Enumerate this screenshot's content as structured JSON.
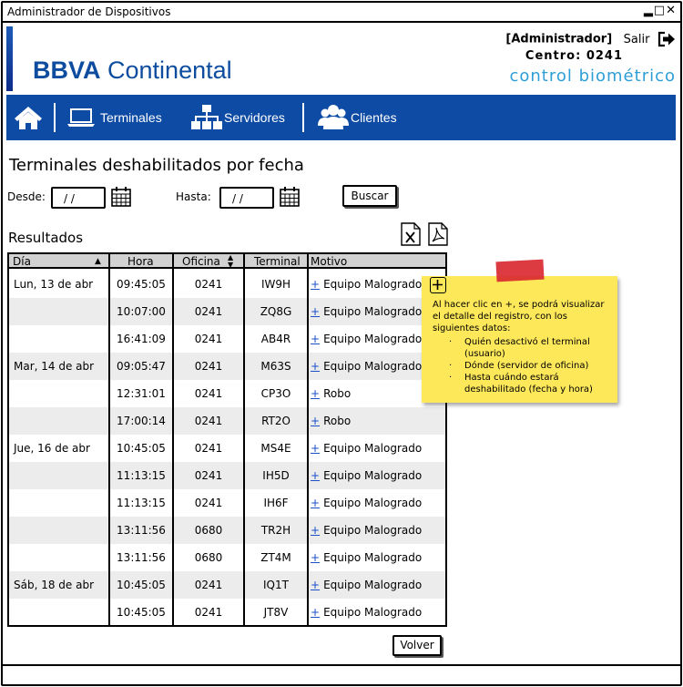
{
  "window": {
    "title": "Administrador de Dispositivos",
    "controls": "▂□✕"
  },
  "brand": {
    "logo_bold": "BBVA",
    "logo_rest": " Continental",
    "subtitle": "control biométrico"
  },
  "user": {
    "role": "[Administrador]",
    "logout": "Salir",
    "centro": "Centro: 0241"
  },
  "nav": [
    {
      "label": "",
      "icon": "home-icon"
    },
    {
      "label": "Terminales",
      "icon": "laptop-icon"
    },
    {
      "label": "Servidores",
      "icon": "sitemap-icon"
    },
    {
      "label": "Clientes",
      "icon": "users-icon"
    }
  ],
  "page": {
    "title": "Terminales deshabilitados por fecha"
  },
  "filters": {
    "desde_label": "Desde:",
    "desde_value": "/  /",
    "hasta_label": "Hasta:",
    "hasta_value": "/  /",
    "search_label": "Buscar"
  },
  "results": {
    "label": "Resultados",
    "excel_icon": "excel-icon",
    "pdf_icon": "pdf-icon"
  },
  "table": {
    "headers": [
      "Día",
      "Hora",
      "Oficina",
      "Terminal",
      "Motivo"
    ],
    "sort_day": "▲",
    "sort_office": "▲▼",
    "plus": "+",
    "rows": [
      {
        "dia": "Lun, 13 de abr",
        "hora": "09:45:05",
        "oficina": "0241",
        "terminal": "IW9H",
        "motivo": "Equipo Malogrado"
      },
      {
        "dia": "",
        "hora": "10:07:00",
        "oficina": "0241",
        "terminal": "ZQ8G",
        "motivo": "Equipo Malogrado"
      },
      {
        "dia": "",
        "hora": "16:41:09",
        "oficina": "0241",
        "terminal": "AB4R",
        "motivo": "Equipo Malogrado"
      },
      {
        "dia": "Mar, 14 de abr",
        "hora": "09:05:47",
        "oficina": "0241",
        "terminal": "M63S",
        "motivo": "Equipo Malogrado"
      },
      {
        "dia": "",
        "hora": "12:31:01",
        "oficina": "0241",
        "terminal": "CP3O",
        "motivo": "Robo"
      },
      {
        "dia": "",
        "hora": "17:00:14",
        "oficina": "0241",
        "terminal": "RT2O",
        "motivo": "Robo"
      },
      {
        "dia": "Jue, 16 de abr",
        "hora": "10:45:05",
        "oficina": "0241",
        "terminal": "MS4E",
        "motivo": "Equipo Malogrado"
      },
      {
        "dia": "",
        "hora": "11:13:15",
        "oficina": "0241",
        "terminal": "IH5D",
        "motivo": "Equipo Malogrado"
      },
      {
        "dia": "",
        "hora": "11:13:15",
        "oficina": "0241",
        "terminal": "IH6F",
        "motivo": "Equipo Malogrado"
      },
      {
        "dia": "",
        "hora": "13:11:56",
        "oficina": "0680",
        "terminal": "TR2H",
        "motivo": "Equipo Malogrado"
      },
      {
        "dia": "",
        "hora": "13:11:56",
        "oficina": "0680",
        "terminal": "ZT4M",
        "motivo": "Equipo Malogrado"
      },
      {
        "dia": "Sáb, 18 de abr",
        "hora": "10:45:05",
        "oficina": "0241",
        "terminal": "IQ1T",
        "motivo": "Equipo Malogrado"
      },
      {
        "dia": "",
        "hora": "10:45:05",
        "oficina": "0241",
        "terminal": "JT8V",
        "motivo": "Equipo Malogrado"
      }
    ]
  },
  "note": {
    "intro": "Al hacer clic en +, se podrá visualizar el detalle del registro, con los siguientes datos:",
    "items": [
      "Quién desactivó el terminal (usuario)",
      "Dónde (servidor de oficina)",
      "Hasta cuándo estará deshabilitado (fecha y hora)"
    ]
  },
  "back_label": "Volver"
}
